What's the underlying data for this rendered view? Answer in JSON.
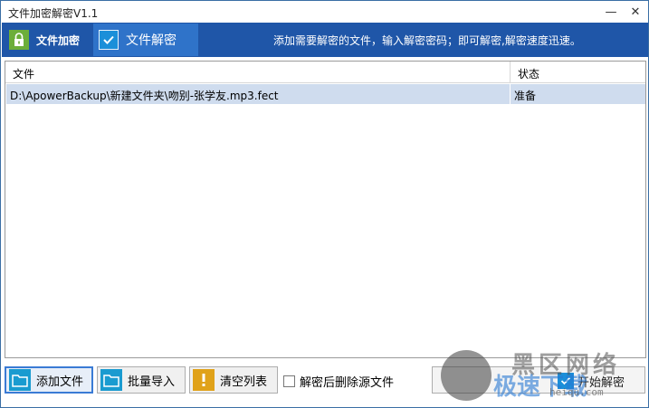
{
  "window": {
    "title": "文件加密解密V1.1",
    "minimize_glyph": "—",
    "close_glyph": "✕"
  },
  "header": {
    "tabs": [
      {
        "label": "文件加密",
        "icon": "lock-icon",
        "active": false
      },
      {
        "label": "文件解密",
        "icon": "check-icon",
        "active": true
      }
    ],
    "hint": "添加需要解密的文件，输入解密密码；即可解密,解密速度迅速。",
    "colors": {
      "bar": "#1f56a8",
      "active_tab": "#2f73c9",
      "lock": "#6cae3a"
    }
  },
  "file_list": {
    "columns": [
      "文件",
      "状态"
    ],
    "rows": [
      {
        "file": "D:\\ApowerBackup\\新建文件夹\\吻别-张学友.mp3.fect",
        "status": "准备"
      }
    ]
  },
  "toolbar": {
    "add_file": "添加文件",
    "batch_import": "批量导入",
    "clear_list": "清空列表",
    "delete_after_decrypt": {
      "label": "解密后删除源文件",
      "checked": false
    },
    "start_decrypt": "开始解密"
  },
  "watermark": {
    "line1": "黑区网络",
    "line2": "极速下载",
    "url": "heiqu.com"
  }
}
